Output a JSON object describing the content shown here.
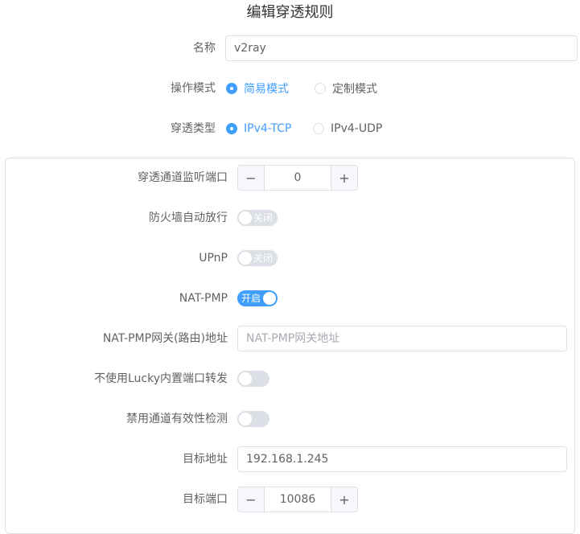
{
  "title": "编辑穿透规则",
  "fields": {
    "name": {
      "label": "名称",
      "value": "v2ray"
    },
    "mode": {
      "label": "操作模式",
      "options": [
        "简易模式",
        "定制模式"
      ],
      "selected": "简易模式"
    },
    "type": {
      "label": "穿透类型",
      "options": [
        "IPv4-TCP",
        "IPv4-UDP"
      ],
      "selected": "IPv4-TCP"
    }
  },
  "panel": {
    "listen_port": {
      "label": "穿透通道监听端口",
      "value": "0",
      "minus": "−",
      "plus": "+"
    },
    "firewall": {
      "label": "防火墙自动放行",
      "state": "关闭"
    },
    "upnp": {
      "label": "UPnP",
      "state": "关闭"
    },
    "natpmp": {
      "label": "NAT-PMP",
      "state": "开启"
    },
    "natpmp_gateway": {
      "label": "NAT-PMP网关(路由)地址",
      "placeholder": "NAT-PMP网关地址"
    },
    "no_builtin_forward": {
      "label": "不使用Lucky内置端口转发",
      "state": ""
    },
    "disable_check": {
      "label": "禁用通道有效性检测",
      "state": ""
    },
    "target_addr": {
      "label": "目标地址",
      "value": "192.168.1.245"
    },
    "target_port": {
      "label": "目标端口",
      "value": "10086",
      "minus": "−",
      "plus": "+"
    }
  },
  "colors": {
    "accent": "#409eff",
    "border": "#dcdfe6",
    "switch_off": "#dcdfe6"
  }
}
